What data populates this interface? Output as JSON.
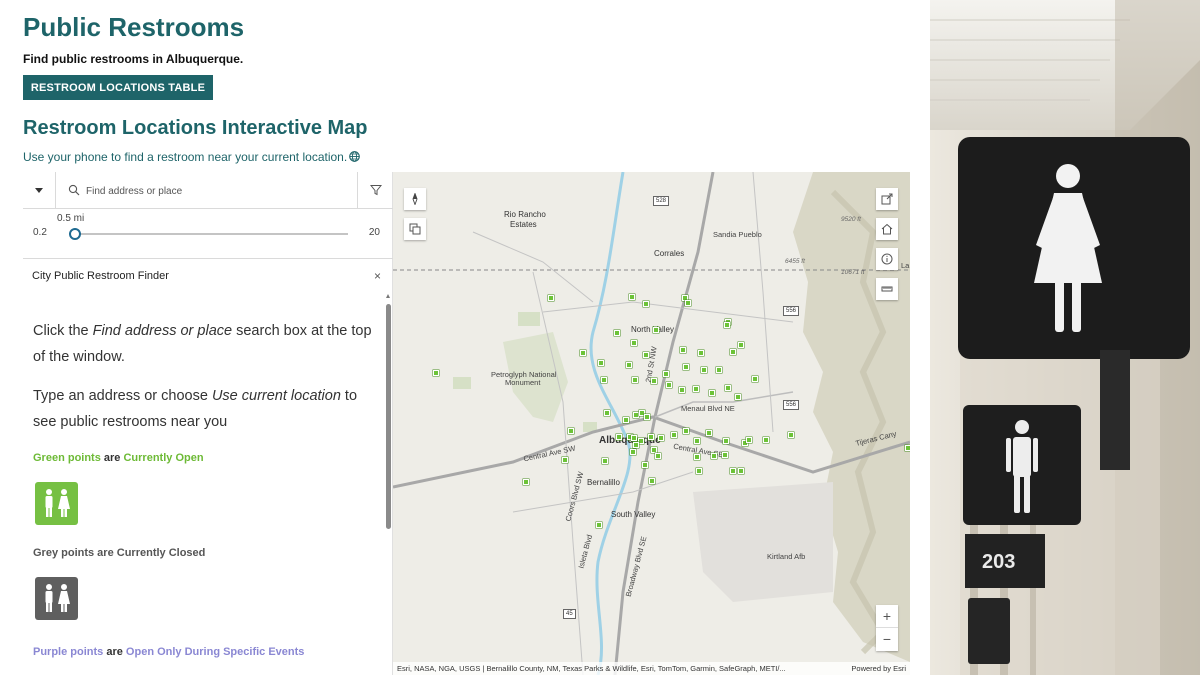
{
  "header": {
    "title": "Public Restrooms",
    "subtitle": "Find public restrooms in Albuquerque.",
    "table_button": "RESTROOM LOCATIONS TABLE"
  },
  "map_section": {
    "heading": "Restroom Locations Interactive Map",
    "intro": "Use your phone to find a restroom near your current location."
  },
  "search": {
    "placeholder": "Find address or place"
  },
  "slider": {
    "value_label": "0.5 mi",
    "min": "0.2",
    "max": "20",
    "value": 0.5
  },
  "finder": {
    "title": "City Public Restroom Finder",
    "close": "×",
    "step1_a": "Click the ",
    "step1_em": "Find address or place",
    "step1_b": " search box at the top of the window.",
    "step2_a": "Type an address or choose ",
    "step2_em": "Use current location",
    "step2_b": " to see public restrooms near you",
    "green_a": "Green points",
    "green_are": " are ",
    "green_b": "Currently Open",
    "grey_text": "Grey points are Currently Closed",
    "purple_a": "Purple points",
    "purple_are": " are ",
    "purple_b": "Open Only During Specific Events"
  },
  "map": {
    "labels": {
      "rio_rancho": "Rio Rancho",
      "estates": "Estates",
      "corrales": "Corrales",
      "sandia_pueblo": "Sandia Pueblo",
      "north_valley": "North Valley",
      "petroglyph": "Petroglyph National",
      "monument": "Monument",
      "albuquerque": "Albuquerque",
      "menaul": "Menaul Blvd NE",
      "central_ave_sw": "Central Ave SW",
      "central_ave_se": "Central Ave SE",
      "bernalillo": "Bernalillo",
      "south_valley": "South Valley",
      "kirtland": "Kirtland Afb",
      "tijeras": "Tijeras Cany",
      "coors": "Coors Blvd SW",
      "isleta": "Isleta Blvd",
      "broadway": "Broadway Blvd SE",
      "second_st": "2nd St NW",
      "elev1": "9520 ft",
      "elev2": "6455 ft",
      "elev3": "10671 ft",
      "la": "La"
    },
    "shields": [
      "528",
      "556",
      "556",
      "45"
    ],
    "attribution": "Esri, NASA, NGA, USGS | Bernalillo County, NM, Texas Parks & Wildlife, Esri, TomTom, Garmin, SafeGraph, METI/...",
    "powered_by": "Powered by Esri",
    "zoom_in": "+",
    "zoom_out": "−"
  },
  "photo": {
    "room_number": "203"
  },
  "colors": {
    "brand": "#1e6469",
    "open_green": "#6dba36",
    "closed_grey": "#5f5f5f",
    "event_purple": "#8a87d3"
  }
}
